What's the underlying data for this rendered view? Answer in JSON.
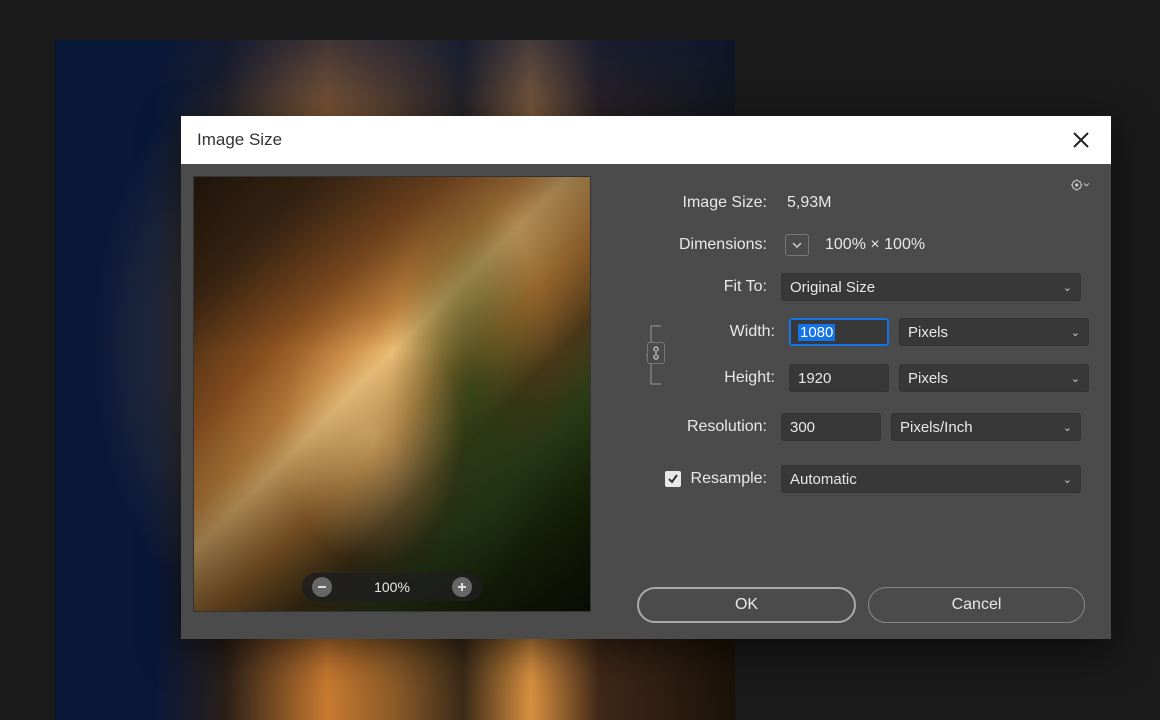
{
  "dialog": {
    "title": "Image Size",
    "image_size_label": "Image Size:",
    "image_size_value": "5,93M",
    "dimensions_label": "Dimensions:",
    "dimensions_value": "100%  ×  100%",
    "fit_to_label": "Fit To:",
    "fit_to_value": "Original Size",
    "width_label": "Width:",
    "width_value": "1080",
    "width_unit": "Pixels",
    "height_label": "Height:",
    "height_value": "1920",
    "height_unit": "Pixels",
    "resolution_label": "Resolution:",
    "resolution_value": "300",
    "resolution_unit": "Pixels/Inch",
    "resample_label": "Resample:",
    "resample_value": "Automatic",
    "resample_checked": true,
    "ok_label": "OK",
    "cancel_label": "Cancel",
    "zoom_level": "100%"
  }
}
